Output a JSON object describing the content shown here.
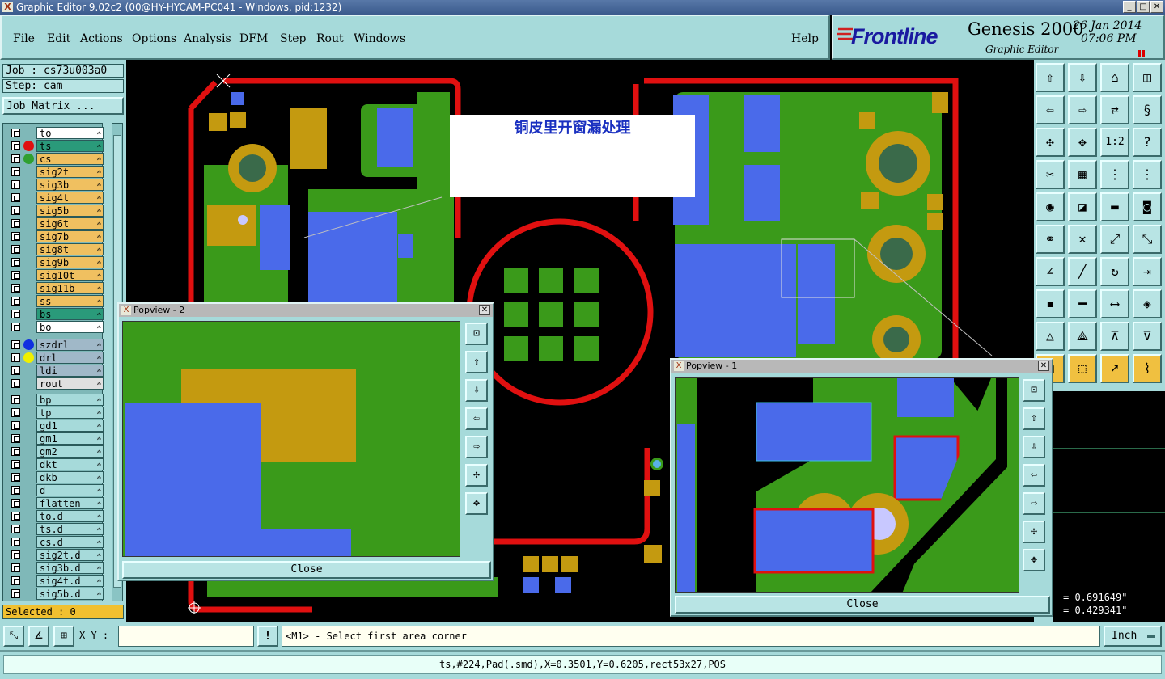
{
  "window": {
    "title": "Graphic Editor 9.02c2 (00@HY-HYCAM-PC041 - Windows, pid:1232)"
  },
  "menu": {
    "file": "File",
    "edit": "Edit",
    "actions": "Actions",
    "options": "Options",
    "analysis": "Analysis",
    "dfm": "DFM",
    "step": "Step",
    "rout": "Rout",
    "windows": "Windows",
    "help": "Help"
  },
  "brand": {
    "logo": "Frontline",
    "product": "Genesis 2000",
    "module": "Graphic Editor",
    "date": "26 Jan 2014",
    "time": "07:06 PM"
  },
  "job": {
    "job_label": "Job : cs73u003a0",
    "step_label": "Step: cam",
    "matrix_button": "Job Matrix ..."
  },
  "layers_board": [
    {
      "name": "to",
      "color": "#ffffff",
      "dot": ""
    },
    {
      "name": "ts",
      "color": "#2a9a7a",
      "dot": "#e01010"
    },
    {
      "name": "cs",
      "color": "#f0c060",
      "dot": "#30a030"
    },
    {
      "name": "sig2t",
      "color": "#f0c060",
      "dot": ""
    },
    {
      "name": "sig3b",
      "color": "#f0c060",
      "dot": ""
    },
    {
      "name": "sig4t",
      "color": "#f0c060",
      "dot": ""
    },
    {
      "name": "sig5b",
      "color": "#f0c060",
      "dot": ""
    },
    {
      "name": "sig6t",
      "color": "#f0c060",
      "dot": ""
    },
    {
      "name": "sig7b",
      "color": "#f0c060",
      "dot": ""
    },
    {
      "name": "sig8t",
      "color": "#f0c060",
      "dot": ""
    },
    {
      "name": "sig9b",
      "color": "#f0c060",
      "dot": ""
    },
    {
      "name": "sig10t",
      "color": "#f0c060",
      "dot": ""
    },
    {
      "name": "sig11b",
      "color": "#f0c060",
      "dot": ""
    },
    {
      "name": "ss",
      "color": "#f0c060",
      "dot": ""
    },
    {
      "name": "bs",
      "color": "#2a9a7a",
      "dot": ""
    },
    {
      "name": "bo",
      "color": "#ffffff",
      "dot": ""
    }
  ],
  "layers_drill": [
    {
      "name": "szdrl",
      "color": "#a0b8c8",
      "dot": "#1030e0"
    },
    {
      "name": "drl",
      "color": "#a0b8c8",
      "dot": "#f0f000"
    },
    {
      "name": "ldi",
      "color": "#a0b8c8",
      "dot": ""
    },
    {
      "name": "rout",
      "color": "#e0e0e0",
      "dot": ""
    }
  ],
  "layers_misc": [
    {
      "name": "bp",
      "color": "#a6dada"
    },
    {
      "name": "tp",
      "color": "#a6dada"
    },
    {
      "name": "gd1",
      "color": "#a6dada"
    },
    {
      "name": "gm1",
      "color": "#a6dada"
    },
    {
      "name": "gm2",
      "color": "#a6dada"
    },
    {
      "name": "dkt",
      "color": "#a6dada"
    },
    {
      "name": "dkb",
      "color": "#a6dada"
    },
    {
      "name": "d",
      "color": "#a6dada"
    },
    {
      "name": "flatten",
      "color": "#a6dada"
    },
    {
      "name": "to.d",
      "color": "#a6dada"
    },
    {
      "name": "ts.d",
      "color": "#a6dada"
    },
    {
      "name": "cs.d",
      "color": "#a6dada"
    },
    {
      "name": "sig2t.d",
      "color": "#a6dada"
    },
    {
      "name": "sig3b.d",
      "color": "#a6dada"
    },
    {
      "name": "sig4t.d",
      "color": "#a6dada"
    },
    {
      "name": "sig5b.d",
      "color": "#a6dada"
    }
  ],
  "selected": "Selected : 0",
  "annotation": "铜皮里开窗漏处理",
  "popup2": {
    "title": "Popview - 2",
    "close": "Close"
  },
  "popup1": {
    "title": "Popview - 1",
    "close": "Close"
  },
  "coords": {
    "x": "= 0.691649\"",
    "y": "= 0.429341\""
  },
  "bottom": {
    "xy_label": "X Y :",
    "xy_value": "",
    "prompt": "<M1> - Select first area corner",
    "units": "Inch"
  },
  "status": "ts,#224,Pad(.smd),X=0.3501,Y=0.6205,rect53x27,POS"
}
